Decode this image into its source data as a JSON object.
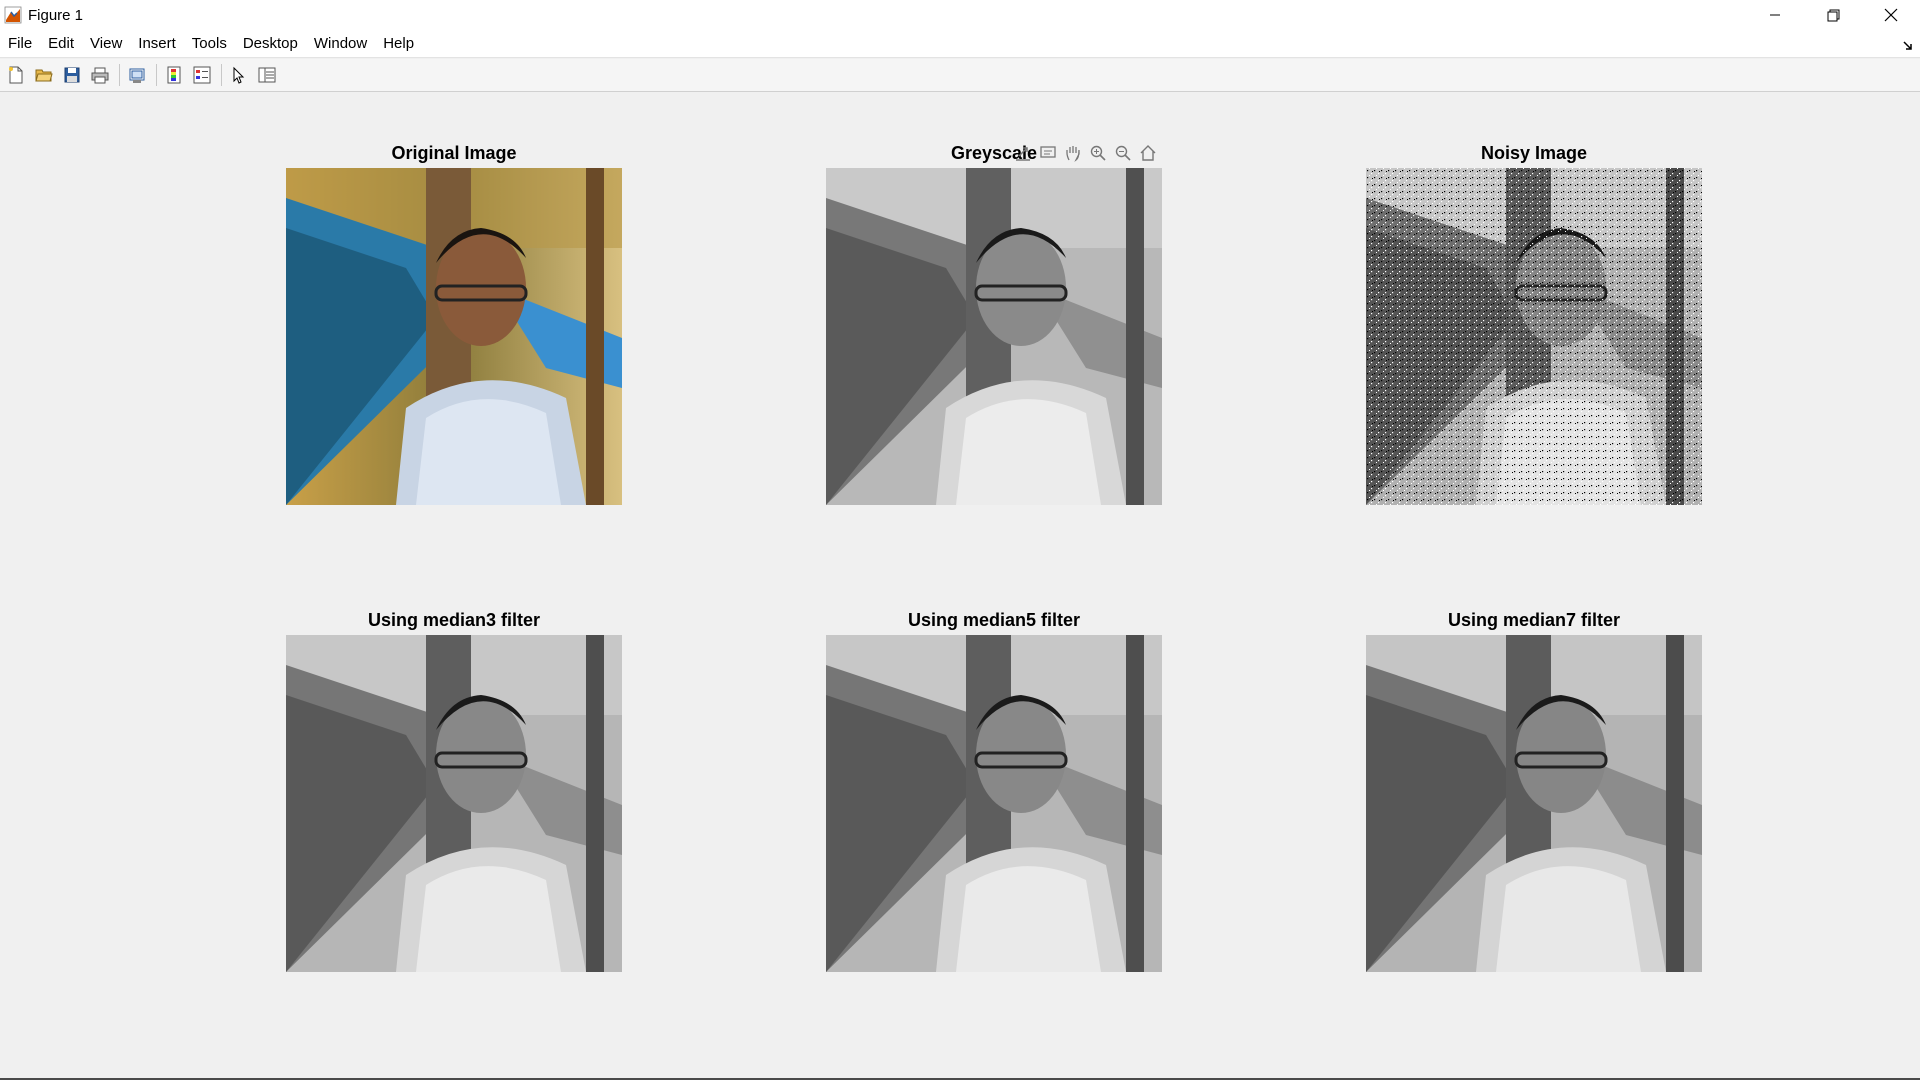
{
  "window": {
    "title": "Figure 1",
    "icon": "matlab-icon"
  },
  "controls": {
    "minimize": "minimize-icon",
    "restore": "restore-icon",
    "close": "close-icon"
  },
  "menu": [
    "File",
    "Edit",
    "View",
    "Insert",
    "Tools",
    "Desktop",
    "Window",
    "Help"
  ],
  "toolbar": [
    "new-figure-icon",
    "open-file-icon",
    "save-icon",
    "print-icon",
    "link-plot-icon",
    "colorbar-icon",
    "legend-icon",
    "edit-plot-icon",
    "property-inspector-icon"
  ],
  "axes_toolbar": [
    "export-icon",
    "data-tips-icon",
    "pan-icon",
    "zoom-in-icon",
    "zoom-out-icon",
    "restore-view-icon"
  ],
  "subplots": [
    {
      "title": "Original Image",
      "type": "color"
    },
    {
      "title": "Greyscale",
      "type": "grey"
    },
    {
      "title": "Noisy Image",
      "type": "noisy"
    },
    {
      "title": "Using median3 filter",
      "type": "grey"
    },
    {
      "title": "Using median5 filter",
      "type": "grey"
    },
    {
      "title": "Using median7 filter",
      "type": "grey"
    }
  ],
  "colors": {
    "background": "#f0f0f0",
    "titlebar": "#ffffff"
  }
}
